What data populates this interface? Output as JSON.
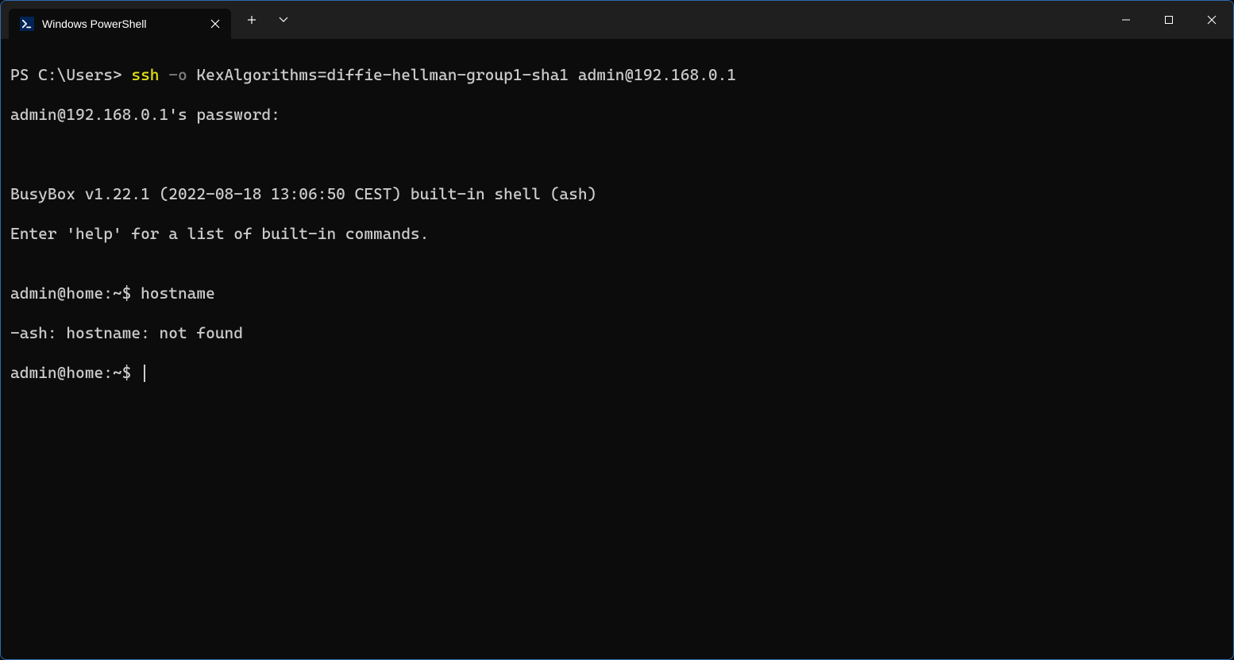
{
  "titlebar": {
    "tab_title": "Windows PowerShell"
  },
  "terminal": {
    "lines": {
      "l1_prompt": "PS C:\\Users> ",
      "l1_cmd": "ssh",
      "l1_flag": " -o",
      "l1_rest": " KexAlgorithms=diffie-hellman-group1-sha1 admin@192.168.0.1",
      "l2": "admin@192.168.0.1's password:",
      "l3": "",
      "l4": "",
      "l5": "BusyBox v1.22.1 (2022-08-18 13:06:50 CEST) built-in shell (ash)",
      "l6": "Enter 'help' for a list of built-in commands.",
      "l7": "",
      "l8": "admin@home:~$ hostname",
      "l9": "-ash: hostname: not found",
      "l10": "admin@home:~$ "
    }
  }
}
